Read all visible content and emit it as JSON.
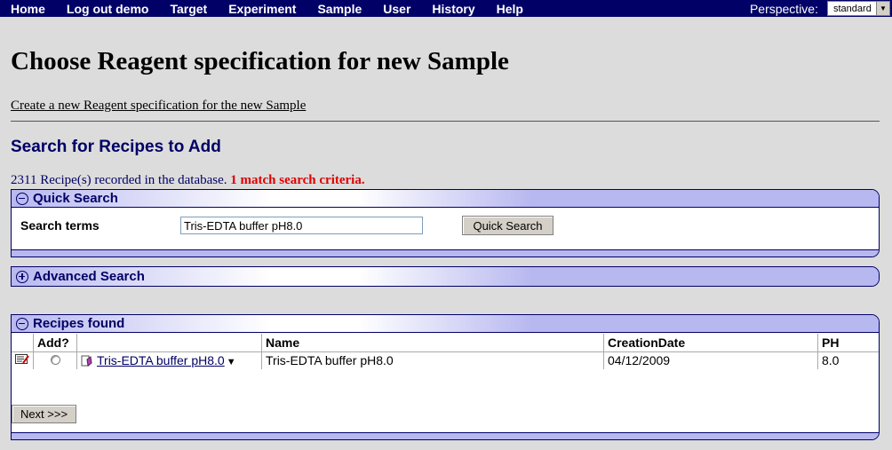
{
  "nav": {
    "items": [
      "Home",
      "Log out demo",
      "Target",
      "Experiment",
      "Sample",
      "User",
      "History",
      "Help"
    ],
    "perspective_label": "Perspective:",
    "perspective_value": "standard"
  },
  "page": {
    "title": "Choose Reagent specification for new Sample",
    "create_link": "Create a new Reagent specification for the new Sample",
    "section_title": "Search for Recipes to Add",
    "count_text": "2311 Recipe(s) recorded in the database.",
    "match_text": "1 match search criteria."
  },
  "quick_search": {
    "title": "Quick Search",
    "label": "Search terms",
    "value": "Tris-EDTA buffer pH8.0",
    "button": "Quick Search"
  },
  "advanced_search": {
    "title": "Advanced Search"
  },
  "recipes": {
    "title": "Recipes found",
    "columns": [
      "",
      "Add?",
      "",
      "Name",
      "CreationDate",
      "PH"
    ],
    "rows": [
      {
        "link": "Tris-EDTA buffer pH8.0",
        "name": "Tris-EDTA buffer pH8.0",
        "date": "04/12/2009",
        "ph": "8.0"
      }
    ],
    "next_button": "Next >>>"
  },
  "colors": {
    "nav_bg": "#000066",
    "accent": "#000066",
    "match": "#e00000",
    "panel_band": "#b8b8f0",
    "page_bg": "#dcdcdc"
  }
}
